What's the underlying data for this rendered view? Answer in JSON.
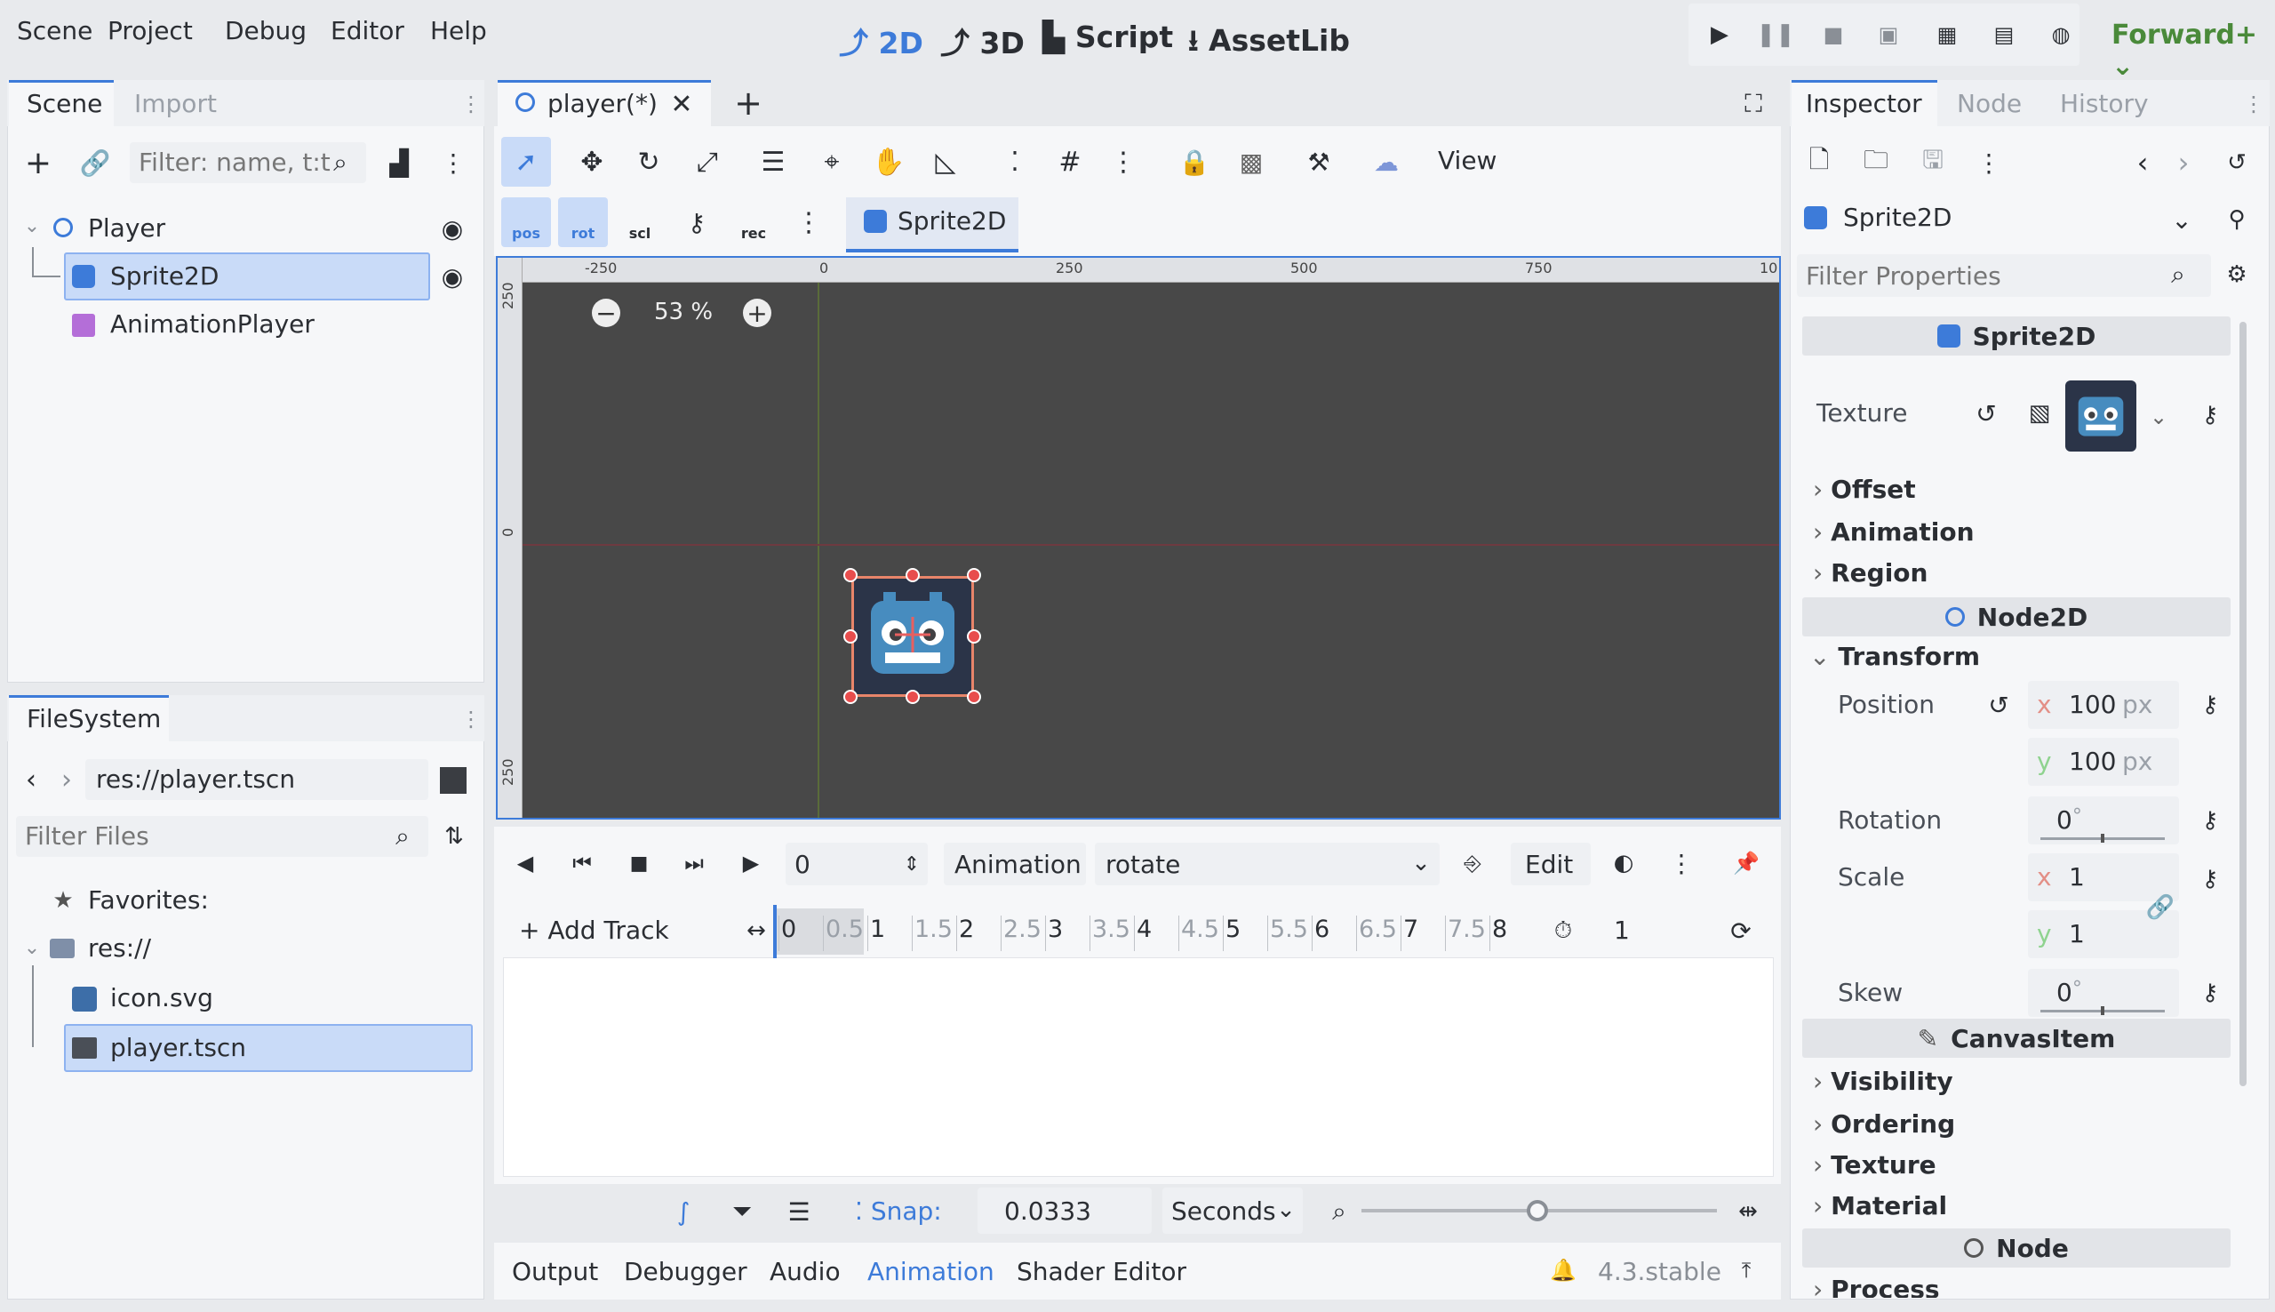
{
  "menu": [
    "Scene",
    "Project",
    "Debug",
    "Editor",
    "Help"
  ],
  "workspaces": {
    "w2d": "2D",
    "w3d": "3D",
    "script": "Script",
    "assetlib": "AssetLib"
  },
  "renderer": "Forward+",
  "scene_dock": {
    "tabs": [
      "Scene",
      "Import"
    ],
    "filter_placeholder": "Filter: name, t:t",
    "nodes": [
      "Player",
      "Sprite2D",
      "AnimationPlayer"
    ]
  },
  "filesystem": {
    "tab": "FileSystem",
    "path": "res://player.tscn",
    "filter_placeholder": "Filter Files",
    "items": [
      "Favorites:",
      "res://",
      "icon.svg",
      "player.tscn"
    ]
  },
  "editor": {
    "tab": "player(*)",
    "view_label": "View",
    "node_label": "Sprite2D",
    "zoom": "53 %",
    "ruler": [
      "-250",
      "0",
      "250",
      "500",
      "750",
      "10"
    ],
    "vruler": [
      "250",
      "0",
      "250"
    ],
    "mode_labels": [
      "pos",
      "rot",
      "scl",
      "rec"
    ]
  },
  "anim": {
    "time": "0",
    "animation_label": "Animation",
    "animation": "rotate",
    "edit": "Edit",
    "add_track": "Add Track",
    "ticks": [
      "0",
      "0.5",
      "1",
      "1.5",
      "2",
      "2.5",
      "3",
      "3.5",
      "4",
      "4.5",
      "5",
      "5.5",
      "6",
      "6.5",
      "7",
      "7.5",
      "8"
    ],
    "length": "1",
    "snap_label": "Snap:",
    "snap": "0.0333",
    "unit": "Seconds"
  },
  "bottom": {
    "tabs": [
      "Output",
      "Debugger",
      "Audio",
      "Animation",
      "Shader Editor"
    ],
    "version": "4.3.stable"
  },
  "inspector": {
    "tabs": [
      "Inspector",
      "Node",
      "History"
    ],
    "object": "Sprite2D",
    "filter_placeholder": "Filter Properties",
    "sprite_hdr": "Sprite2D",
    "texture": "Texture",
    "offset": "Offset",
    "animation": "Animation",
    "region": "Region",
    "node2d_hdr": "Node2D",
    "transform": "Transform",
    "position": "Position",
    "px": "100",
    "py": "100",
    "unit_px": "px",
    "rotation": "Rotation",
    "rot_val": "0",
    "deg": "°",
    "scale": "Scale",
    "sx": "1",
    "sy": "1",
    "skew": "Skew",
    "skew_val": "0",
    "canvas_hdr": "CanvasItem",
    "visibility": "Visibility",
    "ordering": "Ordering",
    "texture2": "Texture",
    "material": "Material",
    "node_hdr": "Node",
    "process": "Process",
    "x": "x",
    "y": "y"
  },
  "colors": {
    "accent": "#3d7bd9",
    "sel": "#c9dbf8",
    "viewport": "#484848",
    "x": "#e38f86",
    "y": "#8fd38f"
  }
}
